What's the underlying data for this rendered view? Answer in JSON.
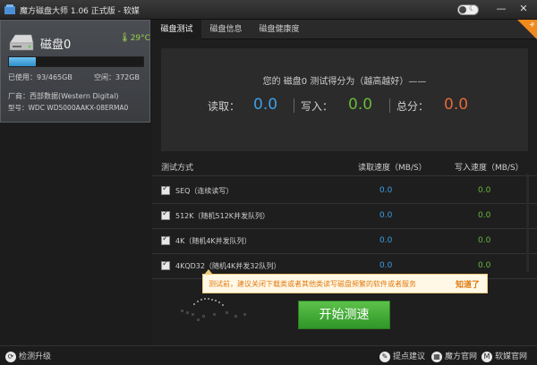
{
  "window": {
    "title": "魔方磁盘大师 1.06 正式版 - 软媒",
    "min_glyph": "—",
    "close_glyph": "✕"
  },
  "disk": {
    "name": "磁盘0",
    "temperature": "29°C",
    "usage_fraction": 0.2,
    "used": "已使用：93/465GB",
    "free": "空闲：372GB",
    "vendor": "厂商：西部数据(Western Digital)",
    "model": "型号：WDC WD5000AAKX-08ERMA0"
  },
  "tabs": [
    {
      "label": "磁盘测试",
      "active": true
    },
    {
      "label": "磁盘信息",
      "active": false
    },
    {
      "label": "磁盘健康度",
      "active": false
    }
  ],
  "score": {
    "title": "您的  磁盘0  测试得分为（越高越好）——",
    "read_label": "读取：",
    "read_value": "0.0",
    "write_label": "写入：",
    "write_value": "0.0",
    "total_label": "总分：",
    "total_value": "0.0"
  },
  "colors": {
    "read": "#3b9ee6",
    "write": "#6ab83a",
    "total": "#e8673a",
    "start": "#3fa834",
    "tip": "#e07a12"
  },
  "table": {
    "col_method": "测试方式",
    "col_read": "读取速度（MB/S）",
    "col_write": "写入速度（MB/S）",
    "rows": [
      {
        "label": "SEQ（连续读写）",
        "read": "0.0",
        "write": "0.0"
      },
      {
        "label": "512K（随机512K并发队列）",
        "read": "0.0",
        "write": "0.0"
      },
      {
        "label": "4K（随机4K并发队列）",
        "read": "0.0",
        "write": "0.0"
      },
      {
        "label": "4KQD32（随机4K并发32队列）",
        "read": "0.0",
        "write": "0.0"
      }
    ]
  },
  "tip": {
    "text": "测试前，建议关闭下载类或者其他类读写磁盘频繁的软件或者服务",
    "ok": "知道了"
  },
  "start_button": "开始测速",
  "statusbar": {
    "update": "检测升级",
    "feedback": "提点建议",
    "site": "魔方官网",
    "ruanmei": "软媒官网",
    "icons": {
      "update": "refresh-icon",
      "feedback": "lightbulb-icon",
      "site": "cube-icon",
      "ruanmei": "m-logo-icon"
    }
  }
}
